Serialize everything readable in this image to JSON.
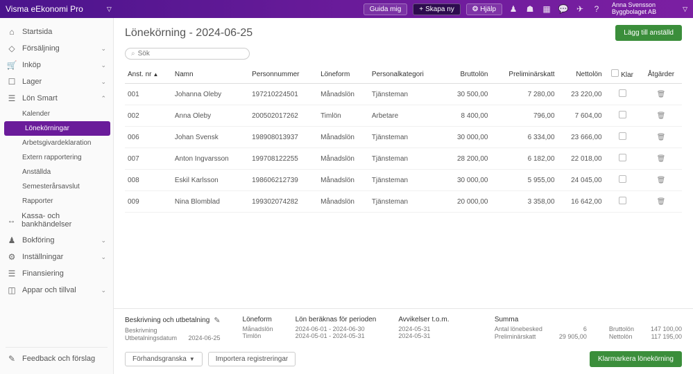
{
  "topbar": {
    "brand": "Visma eEkonomi Pro",
    "guide": "Guida mig",
    "create": "Skapa ny",
    "help": "Hjälp",
    "user_name": "Anna Svensson",
    "user_company": "Byggbolaget AB"
  },
  "sidebar": {
    "startsida": "Startsida",
    "forsaljning": "Försäljning",
    "inkop": "Inköp",
    "lager": "Lager",
    "lon_smart": "Lön Smart",
    "lon_sub": [
      {
        "label": "Kalender"
      },
      {
        "label": "Lönekörningar"
      },
      {
        "label": "Arbetsgivardeklaration"
      },
      {
        "label": "Extern rapportering"
      },
      {
        "label": "Anställda"
      },
      {
        "label": "Semesterårsavslut"
      },
      {
        "label": "Rapporter"
      }
    ],
    "kassa": "Kassa- och bankhändelser",
    "bokforing": "Bokföring",
    "installningar": "Inställningar",
    "finansiering": "Finansiering",
    "appar": "Appar och tillval",
    "feedback": "Feedback och förslag"
  },
  "page": {
    "title": "Lönekörning - 2024-06-25",
    "add_btn": "Lägg till anställd",
    "search_placeholder": "Sök"
  },
  "table": {
    "cols": {
      "anst_nr": "Anst. nr",
      "namn": "Namn",
      "personnummer": "Personnummer",
      "loneform": "Löneform",
      "personalkategori": "Personalkategori",
      "bruttolon": "Bruttolön",
      "prelskatt": "Preliminärskatt",
      "nettolon": "Nettolön",
      "klar": "Klar",
      "atgarder": "Åtgärder"
    },
    "rows": [
      {
        "nr": "001",
        "namn": "Johanna Oleby",
        "pn": "197210224501",
        "lf": "Månadslön",
        "pk": "Tjänsteman",
        "brutto": "30 500,00",
        "prel": "7 280,00",
        "netto": "23 220,00"
      },
      {
        "nr": "002",
        "namn": "Anna Oleby",
        "pn": "200502017262",
        "lf": "Timlön",
        "pk": "Arbetare",
        "brutto": "8 400,00",
        "prel": "796,00",
        "netto": "7 604,00"
      },
      {
        "nr": "006",
        "namn": "Johan Svensk",
        "pn": "198908013937",
        "lf": "Månadslön",
        "pk": "Tjänsteman",
        "brutto": "30 000,00",
        "prel": "6 334,00",
        "netto": "23 666,00"
      },
      {
        "nr": "007",
        "namn": "Anton Ingvarsson",
        "pn": "199708122255",
        "lf": "Månadslön",
        "pk": "Tjänsteman",
        "brutto": "28 200,00",
        "prel": "6 182,00",
        "netto": "22 018,00"
      },
      {
        "nr": "008",
        "namn": "Eskil Karlsson",
        "pn": "198606212739",
        "lf": "Månadslön",
        "pk": "Tjänsteman",
        "brutto": "30 000,00",
        "prel": "5 955,00",
        "netto": "24 045,00"
      },
      {
        "nr": "009",
        "namn": "Nina Blomblad",
        "pn": "199302074282",
        "lf": "Månadslön",
        "pk": "Tjänsteman",
        "brutto": "20 000,00",
        "prel": "3 358,00",
        "netto": "16 642,00"
      }
    ]
  },
  "footer_info": {
    "desc_head": "Beskrivning och utbetalning",
    "desc_label": "Beskrivning",
    "pay_label": "Utbetalningsdatum",
    "pay_date": "2024-06-25",
    "loneform_head": "Löneform",
    "loneform_a": "Månadslön",
    "loneform_b": "Timlön",
    "period_head": "Lön beräknas för perioden",
    "period_a": "2024-06-01 - 2024-06-30",
    "period_b": "2024-05-01 - 2024-05-31",
    "avvik_head": "Avvikelser t.o.m.",
    "avvik_a": "2024-05-31",
    "avvik_b": "2024-05-31",
    "summa_head": "Summa",
    "antal_label": "Antal lönebesked",
    "antal_val": "6",
    "prel_label": "Preliminärskatt",
    "prel_val": "29 905,00",
    "brutto_label": "Bruttolön",
    "brutto_val": "147 100,00",
    "netto_label": "Nettolön",
    "netto_val": "117 195,00"
  },
  "footer_actions": {
    "preview": "Förhandsgranska",
    "import": "Importera registreringar",
    "klarmarkera": "Klarmarkera lönekörning"
  }
}
